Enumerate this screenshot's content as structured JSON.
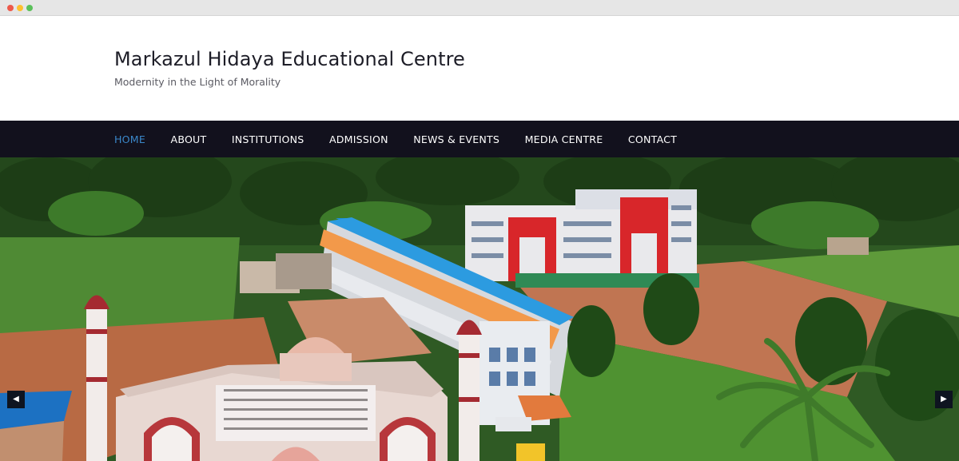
{
  "site": {
    "title": "Markazul Hidaya Educational Centre",
    "tagline": "Modernity in the Light of Morality"
  },
  "nav": {
    "items": [
      {
        "label": "HOME",
        "active": true
      },
      {
        "label": "ABOUT",
        "active": false
      },
      {
        "label": "INSTITUTIONS",
        "active": false
      },
      {
        "label": "ADMISSION",
        "active": false
      },
      {
        "label": "NEWS & EVENTS",
        "active": false
      },
      {
        "label": "MEDIA CENTRE",
        "active": false
      },
      {
        "label": "CONTACT",
        "active": false
      }
    ]
  },
  "slider": {
    "prev_icon": "chevron-left-icon",
    "next_icon": "chevron-right-icon",
    "prev_glyph": "◀",
    "next_glyph": "▶"
  },
  "colors": {
    "nav_background": "#12111d",
    "nav_active": "#3a87c9",
    "title": "#1d1d27"
  }
}
